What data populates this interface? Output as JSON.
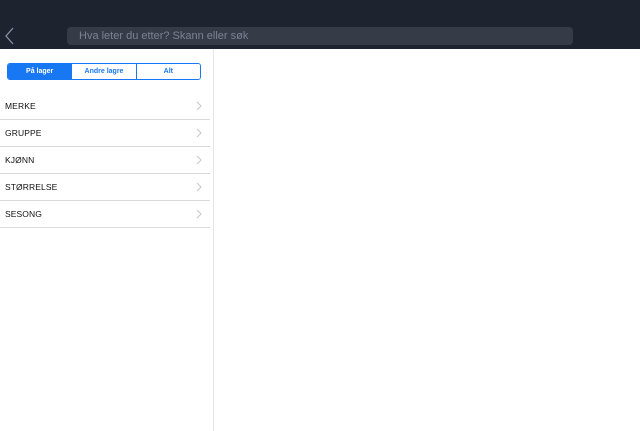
{
  "header": {
    "search_placeholder": "Hva leter du etter? Skann eller søk",
    "search_value": ""
  },
  "filter": {
    "segments": [
      {
        "label": "På lager",
        "selected": true
      },
      {
        "label": "Andre lagre",
        "selected": false
      },
      {
        "label": "Alt",
        "selected": false
      }
    ]
  },
  "sidebar": {
    "items": [
      {
        "label": "MERKE"
      },
      {
        "label": "GRUPPE"
      },
      {
        "label": "KJØNN"
      },
      {
        "label": "STØRRELSE"
      },
      {
        "label": "SESONG"
      }
    ]
  },
  "colors": {
    "topbar": "#1e2330",
    "search_field": "#363b48",
    "accent": "#1877f2"
  },
  "icons": {
    "back": "chevron-left-icon",
    "row": "chevron-right-icon"
  }
}
